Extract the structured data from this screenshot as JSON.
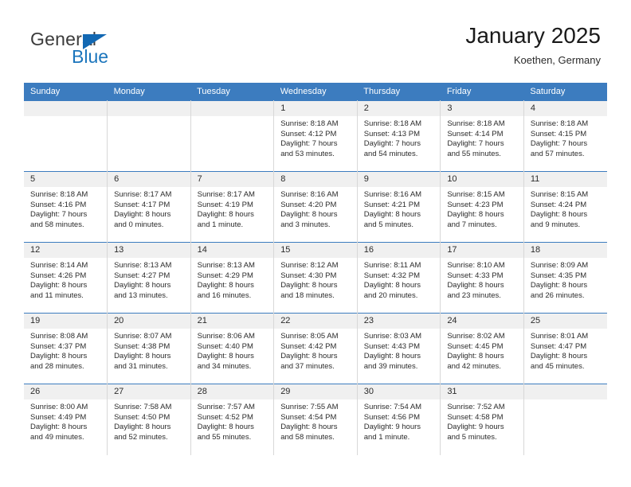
{
  "brand": {
    "name_top": "General",
    "name_bottom": "Blue",
    "triangle_icon": "triangle-icon",
    "accent_blue": "#1b75bc"
  },
  "header": {
    "title": "January 2025",
    "subtitle": "Koethen, Germany"
  },
  "theme": {
    "header_blue": "#3c7cbf",
    "daynum_strip": "#f0f0f0",
    "cell_background": "#ffffff",
    "text": "#2b2b2b"
  },
  "calendar": {
    "weekday_headers": [
      "Sunday",
      "Monday",
      "Tuesday",
      "Wednesday",
      "Thursday",
      "Friday",
      "Saturday"
    ],
    "weeks": [
      [
        {
          "day": "",
          "empty": true,
          "sunrise": "",
          "sunset": "",
          "daylight_1": "",
          "daylight_2": ""
        },
        {
          "day": "",
          "empty": true,
          "sunrise": "",
          "sunset": "",
          "daylight_1": "",
          "daylight_2": ""
        },
        {
          "day": "",
          "empty": true,
          "sunrise": "",
          "sunset": "",
          "daylight_1": "",
          "daylight_2": ""
        },
        {
          "day": "1",
          "empty": false,
          "sunrise": "Sunrise: 8:18 AM",
          "sunset": "Sunset: 4:12 PM",
          "daylight_1": "Daylight: 7 hours",
          "daylight_2": "and 53 minutes."
        },
        {
          "day": "2",
          "empty": false,
          "sunrise": "Sunrise: 8:18 AM",
          "sunset": "Sunset: 4:13 PM",
          "daylight_1": "Daylight: 7 hours",
          "daylight_2": "and 54 minutes."
        },
        {
          "day": "3",
          "empty": false,
          "sunrise": "Sunrise: 8:18 AM",
          "sunset": "Sunset: 4:14 PM",
          "daylight_1": "Daylight: 7 hours",
          "daylight_2": "and 55 minutes."
        },
        {
          "day": "4",
          "empty": false,
          "sunrise": "Sunrise: 8:18 AM",
          "sunset": "Sunset: 4:15 PM",
          "daylight_1": "Daylight: 7 hours",
          "daylight_2": "and 57 minutes."
        }
      ],
      [
        {
          "day": "5",
          "empty": false,
          "sunrise": "Sunrise: 8:18 AM",
          "sunset": "Sunset: 4:16 PM",
          "daylight_1": "Daylight: 7 hours",
          "daylight_2": "and 58 minutes."
        },
        {
          "day": "6",
          "empty": false,
          "sunrise": "Sunrise: 8:17 AM",
          "sunset": "Sunset: 4:17 PM",
          "daylight_1": "Daylight: 8 hours",
          "daylight_2": "and 0 minutes."
        },
        {
          "day": "7",
          "empty": false,
          "sunrise": "Sunrise: 8:17 AM",
          "sunset": "Sunset: 4:19 PM",
          "daylight_1": "Daylight: 8 hours",
          "daylight_2": "and 1 minute."
        },
        {
          "day": "8",
          "empty": false,
          "sunrise": "Sunrise: 8:16 AM",
          "sunset": "Sunset: 4:20 PM",
          "daylight_1": "Daylight: 8 hours",
          "daylight_2": "and 3 minutes."
        },
        {
          "day": "9",
          "empty": false,
          "sunrise": "Sunrise: 8:16 AM",
          "sunset": "Sunset: 4:21 PM",
          "daylight_1": "Daylight: 8 hours",
          "daylight_2": "and 5 minutes."
        },
        {
          "day": "10",
          "empty": false,
          "sunrise": "Sunrise: 8:15 AM",
          "sunset": "Sunset: 4:23 PM",
          "daylight_1": "Daylight: 8 hours",
          "daylight_2": "and 7 minutes."
        },
        {
          "day": "11",
          "empty": false,
          "sunrise": "Sunrise: 8:15 AM",
          "sunset": "Sunset: 4:24 PM",
          "daylight_1": "Daylight: 8 hours",
          "daylight_2": "and 9 minutes."
        }
      ],
      [
        {
          "day": "12",
          "empty": false,
          "sunrise": "Sunrise: 8:14 AM",
          "sunset": "Sunset: 4:26 PM",
          "daylight_1": "Daylight: 8 hours",
          "daylight_2": "and 11 minutes."
        },
        {
          "day": "13",
          "empty": false,
          "sunrise": "Sunrise: 8:13 AM",
          "sunset": "Sunset: 4:27 PM",
          "daylight_1": "Daylight: 8 hours",
          "daylight_2": "and 13 minutes."
        },
        {
          "day": "14",
          "empty": false,
          "sunrise": "Sunrise: 8:13 AM",
          "sunset": "Sunset: 4:29 PM",
          "daylight_1": "Daylight: 8 hours",
          "daylight_2": "and 16 minutes."
        },
        {
          "day": "15",
          "empty": false,
          "sunrise": "Sunrise: 8:12 AM",
          "sunset": "Sunset: 4:30 PM",
          "daylight_1": "Daylight: 8 hours",
          "daylight_2": "and 18 minutes."
        },
        {
          "day": "16",
          "empty": false,
          "sunrise": "Sunrise: 8:11 AM",
          "sunset": "Sunset: 4:32 PM",
          "daylight_1": "Daylight: 8 hours",
          "daylight_2": "and 20 minutes."
        },
        {
          "day": "17",
          "empty": false,
          "sunrise": "Sunrise: 8:10 AM",
          "sunset": "Sunset: 4:33 PM",
          "daylight_1": "Daylight: 8 hours",
          "daylight_2": "and 23 minutes."
        },
        {
          "day": "18",
          "empty": false,
          "sunrise": "Sunrise: 8:09 AM",
          "sunset": "Sunset: 4:35 PM",
          "daylight_1": "Daylight: 8 hours",
          "daylight_2": "and 26 minutes."
        }
      ],
      [
        {
          "day": "19",
          "empty": false,
          "sunrise": "Sunrise: 8:08 AM",
          "sunset": "Sunset: 4:37 PM",
          "daylight_1": "Daylight: 8 hours",
          "daylight_2": "and 28 minutes."
        },
        {
          "day": "20",
          "empty": false,
          "sunrise": "Sunrise: 8:07 AM",
          "sunset": "Sunset: 4:38 PM",
          "daylight_1": "Daylight: 8 hours",
          "daylight_2": "and 31 minutes."
        },
        {
          "day": "21",
          "empty": false,
          "sunrise": "Sunrise: 8:06 AM",
          "sunset": "Sunset: 4:40 PM",
          "daylight_1": "Daylight: 8 hours",
          "daylight_2": "and 34 minutes."
        },
        {
          "day": "22",
          "empty": false,
          "sunrise": "Sunrise: 8:05 AM",
          "sunset": "Sunset: 4:42 PM",
          "daylight_1": "Daylight: 8 hours",
          "daylight_2": "and 37 minutes."
        },
        {
          "day": "23",
          "empty": false,
          "sunrise": "Sunrise: 8:03 AM",
          "sunset": "Sunset: 4:43 PM",
          "daylight_1": "Daylight: 8 hours",
          "daylight_2": "and 39 minutes."
        },
        {
          "day": "24",
          "empty": false,
          "sunrise": "Sunrise: 8:02 AM",
          "sunset": "Sunset: 4:45 PM",
          "daylight_1": "Daylight: 8 hours",
          "daylight_2": "and 42 minutes."
        },
        {
          "day": "25",
          "empty": false,
          "sunrise": "Sunrise: 8:01 AM",
          "sunset": "Sunset: 4:47 PM",
          "daylight_1": "Daylight: 8 hours",
          "daylight_2": "and 45 minutes."
        }
      ],
      [
        {
          "day": "26",
          "empty": false,
          "sunrise": "Sunrise: 8:00 AM",
          "sunset": "Sunset: 4:49 PM",
          "daylight_1": "Daylight: 8 hours",
          "daylight_2": "and 49 minutes."
        },
        {
          "day": "27",
          "empty": false,
          "sunrise": "Sunrise: 7:58 AM",
          "sunset": "Sunset: 4:50 PM",
          "daylight_1": "Daylight: 8 hours",
          "daylight_2": "and 52 minutes."
        },
        {
          "day": "28",
          "empty": false,
          "sunrise": "Sunrise: 7:57 AM",
          "sunset": "Sunset: 4:52 PM",
          "daylight_1": "Daylight: 8 hours",
          "daylight_2": "and 55 minutes."
        },
        {
          "day": "29",
          "empty": false,
          "sunrise": "Sunrise: 7:55 AM",
          "sunset": "Sunset: 4:54 PM",
          "daylight_1": "Daylight: 8 hours",
          "daylight_2": "and 58 minutes."
        },
        {
          "day": "30",
          "empty": false,
          "sunrise": "Sunrise: 7:54 AM",
          "sunset": "Sunset: 4:56 PM",
          "daylight_1": "Daylight: 9 hours",
          "daylight_2": "and 1 minute."
        },
        {
          "day": "31",
          "empty": false,
          "sunrise": "Sunrise: 7:52 AM",
          "sunset": "Sunset: 4:58 PM",
          "daylight_1": "Daylight: 9 hours",
          "daylight_2": "and 5 minutes."
        },
        {
          "day": "",
          "empty": true,
          "sunrise": "",
          "sunset": "",
          "daylight_1": "",
          "daylight_2": ""
        }
      ]
    ]
  }
}
